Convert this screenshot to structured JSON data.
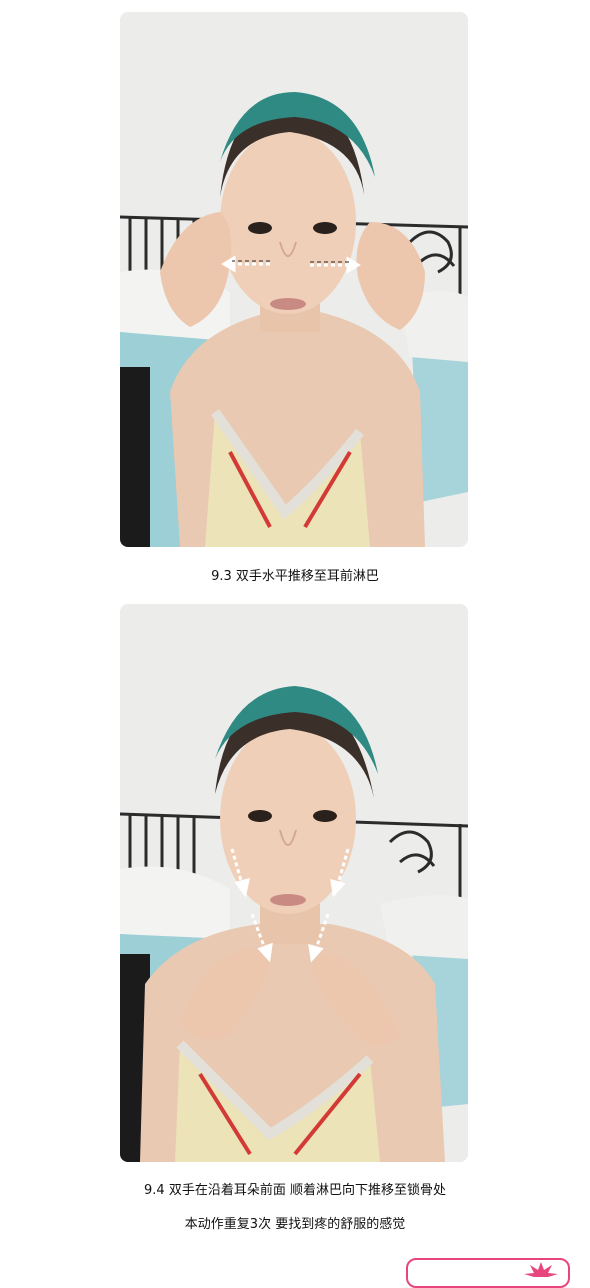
{
  "steps": [
    {
      "caption": "9.3  双手水平推移至耳前淋巴",
      "photo_icon": "face-massage-horizontal-photo"
    },
    {
      "caption_line1": "9.4 双手在沿着耳朵前面 顺着淋巴向下推移至锁骨处",
      "caption_line2": "本动作重复3次 要找到疼的舒服的感觉",
      "photo_icon": "face-massage-downward-photo"
    }
  ],
  "colors": {
    "accent_pink": "#e8457e",
    "headband_teal": "#2e8a82",
    "arrow_white": "#ffffff"
  }
}
